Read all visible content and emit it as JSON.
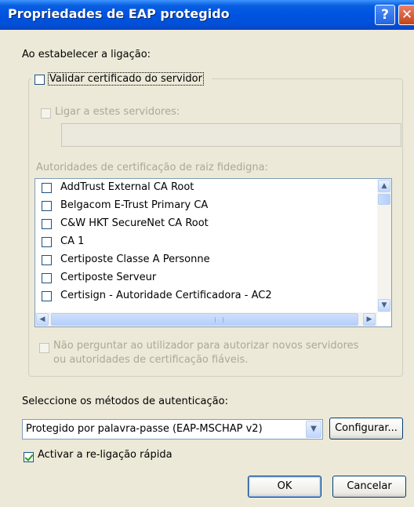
{
  "window": {
    "title": "Propriedades de EAP protegido"
  },
  "titlebar": {
    "help_glyph": "?",
    "close_glyph": "✕"
  },
  "connect": {
    "heading": "Ao estabelecer a ligação:",
    "validate_cert": {
      "label": "Validar certificado do servidor",
      "checked": false
    },
    "connect_servers": {
      "label": "Ligar a estes servidores:",
      "checked": false,
      "value": ""
    },
    "root_ca_label": "Autoridades de certificação de raiz fidedigna:",
    "ca_list": [
      {
        "label": "AddTrust External CA Root",
        "checked": false
      },
      {
        "label": "Belgacom E-Trust Primary CA",
        "checked": false
      },
      {
        "label": "C&W HKT SecureNet CA Root",
        "checked": false
      },
      {
        "label": "CA 1",
        "checked": false
      },
      {
        "label": "Certiposte Classe A Personne",
        "checked": false
      },
      {
        "label": "Certiposte Serveur",
        "checked": false
      },
      {
        "label": "Certisign - Autoridade Certificadora - AC2",
        "checked": false
      }
    ],
    "no_prompt": {
      "line1": "Não perguntar ao utilizador para autorizar novos servidores",
      "line2": "ou autoridades de certificação fiáveis.",
      "checked": false
    }
  },
  "auth": {
    "label": "Seleccione os métodos de autenticação:",
    "method_selected": "Protegido por palavra-passe (EAP-MSCHAP v2)",
    "configure_label": "Configurar...",
    "fast_reconnect": {
      "label": "Activar a re-ligação rápida",
      "checked": true
    }
  },
  "footer": {
    "ok_label": "OK",
    "cancel_label": "Cancelar"
  },
  "colors": {
    "titlebar": "#0054e3",
    "dialog_bg": "#ece9d8",
    "disabled_text": "#aca899",
    "border_blue": "#7f9db9"
  }
}
